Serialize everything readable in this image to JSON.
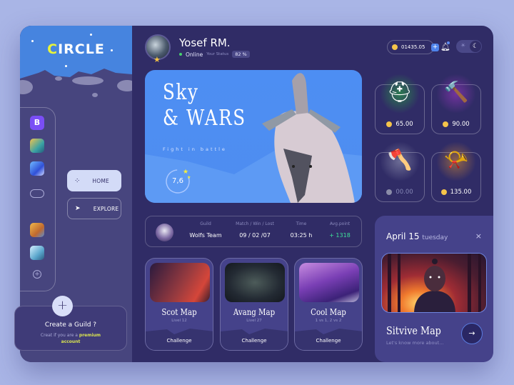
{
  "app": {
    "logo_first": "C",
    "logo_rest": "IRCLE"
  },
  "sidebar": {
    "apps": [
      {
        "name": "bereal-app",
        "color": "#7a4ef5"
      },
      {
        "name": "game-app-1",
        "color": "#3aa3a5"
      },
      {
        "name": "game-app-2",
        "color": "#4c6de6"
      },
      {
        "name": "gamepad",
        "color": ""
      },
      {
        "name": "game-app-3",
        "color": "#d99a3b"
      },
      {
        "name": "game-app-4",
        "color": "#5a9ccc"
      }
    ],
    "nav": [
      {
        "label": "HOME",
        "icon": "grid-icon",
        "active": true
      },
      {
        "label": "EXPLORE",
        "icon": "navigation-icon",
        "active": false
      }
    ],
    "guild": {
      "title": "Create a Guild ?",
      "text": "Creat if you are a",
      "highlight": "premium",
      "highlight2": "account",
      "plus": "+"
    }
  },
  "header": {
    "user_name": "Yosef RM.",
    "status": "Online",
    "status_label": "Your Status",
    "status_pct": "82 %",
    "coins": "01435.05",
    "add": "+"
  },
  "hero": {
    "title_line1": "Sky",
    "title_line2": "& WARS",
    "tagline": "Fight in battle",
    "score": "7,6"
  },
  "items": [
    {
      "name": "helmet",
      "price": "65.00",
      "available": true,
      "glyph": "⛑",
      "glow": "#29c93a"
    },
    {
      "name": "hammer",
      "price": "90.00",
      "available": true,
      "glyph": "🔨",
      "glow": "#b43ad6"
    },
    {
      "name": "axe",
      "price": "00.00",
      "available": false,
      "glyph": "🪓",
      "glow": "#aab0c8"
    },
    {
      "name": "horn",
      "price": "135.00",
      "available": true,
      "glyph": "📯",
      "glow": "#f29a2a"
    }
  ],
  "stats": {
    "headers": [
      "Guild",
      "Match / Win / Lost",
      "Time",
      "Avg.point"
    ],
    "values": [
      "Wolfs Team",
      "09 / 02 /07",
      "03:25 h",
      "+ 1318"
    ]
  },
  "maps": [
    {
      "title": "Scot Map",
      "sub": "Livel 12",
      "cta": "Challenge"
    },
    {
      "title": "Avang Map",
      "sub": "Livel 27",
      "cta": "Challenge"
    },
    {
      "title": "Cool Map",
      "sub": "1 vs 1, 2 vs 2",
      "cta": "Challenge"
    }
  ],
  "event": {
    "date": "April 15",
    "day": "tuesday",
    "close": "×",
    "title": "Sitvive Map",
    "sub": "Let's know more about...",
    "go": "→"
  }
}
